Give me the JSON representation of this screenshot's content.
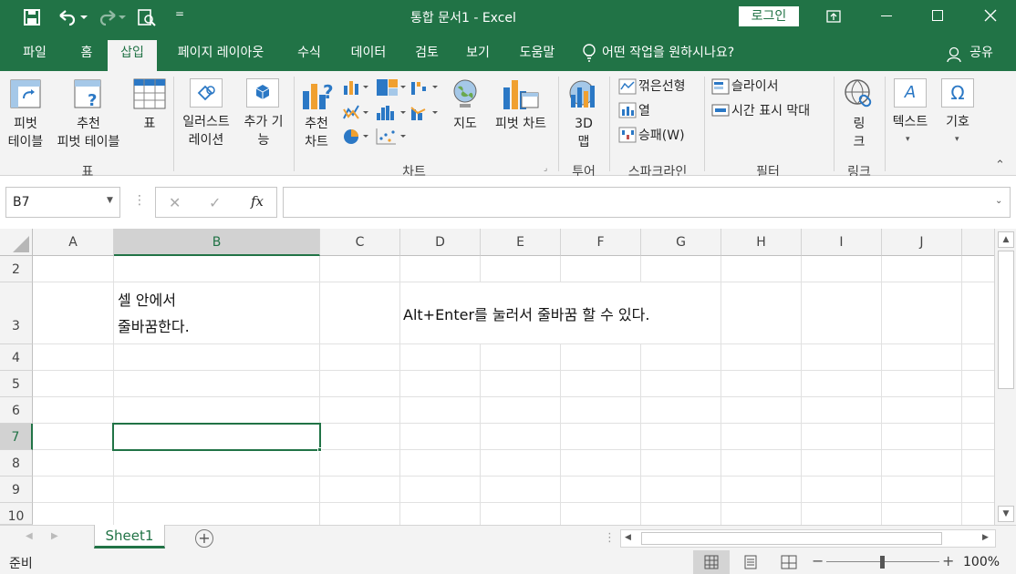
{
  "titlebar": {
    "doc_title": "통합 문서1  -  Excel",
    "login": "로그인",
    "qat_more": "="
  },
  "tabs": [
    "파일",
    "홈",
    "삽입",
    "페이지 레이아웃",
    "수식",
    "데이터",
    "검토",
    "보기",
    "도움말"
  ],
  "tell_me": "어떤 작업을 원하시나요?",
  "share": "공유",
  "ribbon": {
    "pivot_table": [
      "피벗",
      "테이블"
    ],
    "rec_pivot": [
      "추천",
      "피벗 테이블"
    ],
    "table": "표",
    "group_table": "표",
    "illustration": [
      "일러스트",
      "레이션"
    ],
    "addins": [
      "추가 기",
      "능"
    ],
    "rec_charts": [
      "추천",
      "차트"
    ],
    "maps": "지도",
    "pivot_chart": "피벗 차트",
    "group_charts": "차트",
    "map3d": [
      "3D",
      "맵"
    ],
    "group_tour": "투어",
    "spark_line": "꺾은선형",
    "spark_col": "열",
    "spark_win": "승패(W)",
    "group_spark": "스파크라인",
    "slicer": "슬라이서",
    "timeline": "시간 표시 막대",
    "group_filter": "필터",
    "link": [
      "링",
      "크"
    ],
    "group_link": "링크",
    "text": "텍스트",
    "symbol": "기호"
  },
  "formula_bar": {
    "namebox": "B7",
    "fx": "fx",
    "value": ""
  },
  "columns": [
    "A",
    "B",
    "C",
    "D",
    "E",
    "F",
    "G",
    "H",
    "I",
    "J"
  ],
  "rows": [
    "2",
    "3",
    "4",
    "5",
    "6",
    "7",
    "8",
    "9",
    "10"
  ],
  "cells": {
    "b3_line1": "셀 안에서",
    "b3_line2": "줄바꿈한다.",
    "d3": "Alt+Enter를 눌러서 줄바꿈 할 수 있다."
  },
  "sheet_tab": "Sheet1",
  "status": {
    "ready": "준비",
    "zoom": "100%"
  },
  "colors": {
    "accent": "#217346",
    "ribbon_bg": "#f3f3f3"
  }
}
